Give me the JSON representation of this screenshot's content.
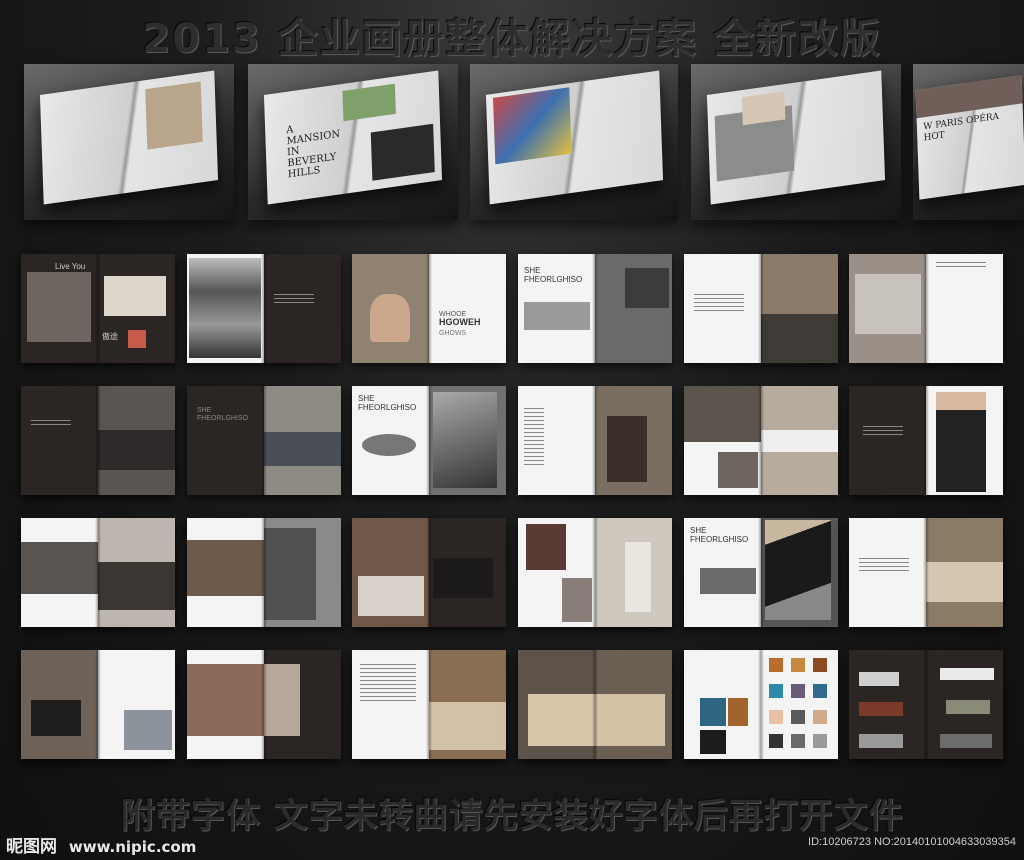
{
  "header": {
    "title": "2013 企业画册整体解决方案  全新改版"
  },
  "top_photos": [
    {
      "title": ""
    },
    {
      "title": "A MANSION IN BEVERLY HILLS"
    },
    {
      "title": ""
    },
    {
      "title": ""
    },
    {
      "title": "W PARIS OPÉRA HOT"
    }
  ],
  "spreads": {
    "s1_tag": "Live You",
    "s1_brand": "傲途",
    "s3_title_1": "WHOOE",
    "s3_title_2": "HGOWEH",
    "s3_title_3": "GHOWS",
    "s4_title_1": "SHE",
    "s4_title_2": "FHEORLGHISO",
    "s8_title_1": "SHE",
    "s8_title_2": "FHEORLGHISO",
    "s9_title_1": "SHE",
    "s9_title_2": "FHEORLGHISO",
    "s23_title_1": "SHE",
    "s23_title_2": "FHEORLGHISO"
  },
  "footer": {
    "note": "附带字体  文字未转曲请先安装好字体后再打开文件"
  },
  "watermark": {
    "brand": "昵图网",
    "site": "www.nipic.com",
    "id": "ID:10206723 NO:20140101004633039354"
  },
  "colors": {
    "background": "#151515",
    "dark_page": "#2b2524",
    "light_page": "#f4f4f4"
  }
}
